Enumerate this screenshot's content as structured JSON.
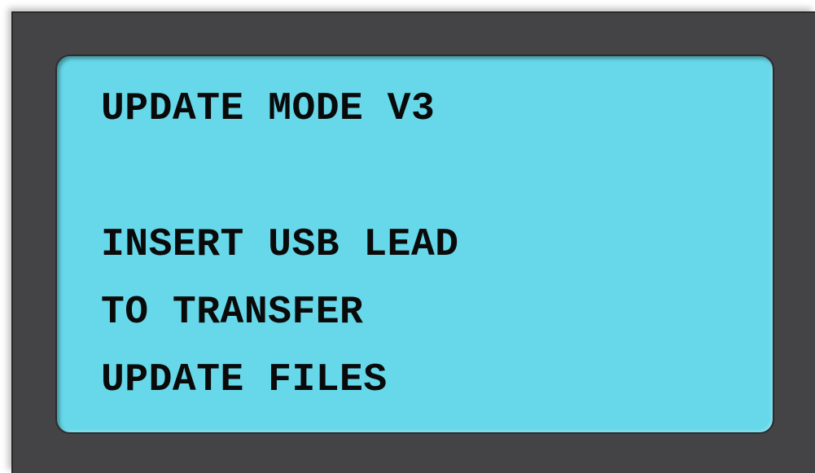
{
  "screen": {
    "lines": [
      "UPDATE MODE V3",
      "",
      "INSERT USB LEAD",
      "TO TRANSFER",
      "UPDATE FILES"
    ]
  },
  "colors": {
    "frame": "#444446",
    "lcd_background": "#66d8e9",
    "lcd_text": "#0a0a0a"
  }
}
